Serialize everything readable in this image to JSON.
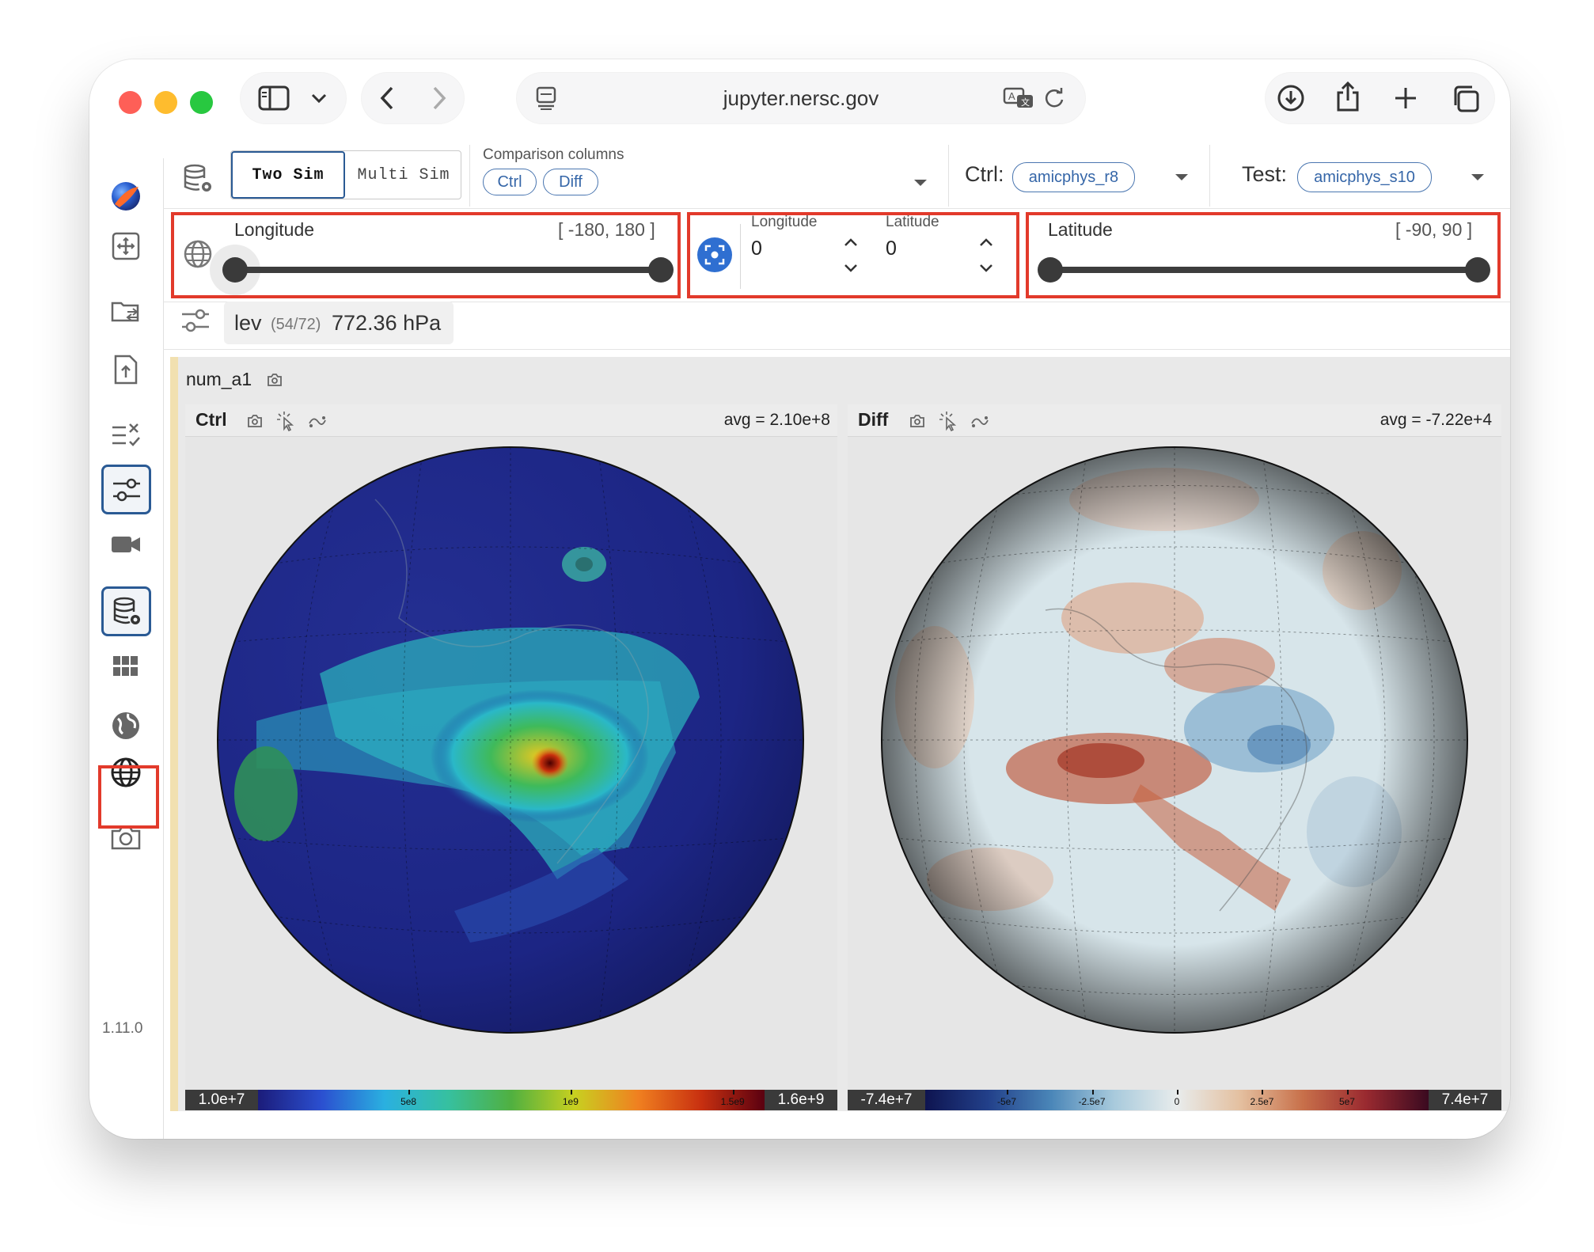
{
  "browser": {
    "url": "jupyter.nersc.gov",
    "traffic_colors": [
      "#fe5f57",
      "#febc2e",
      "#28c840"
    ]
  },
  "toolbar": {
    "mode_tabs": [
      {
        "label": "Two Sim",
        "active": true
      },
      {
        "label": "Multi Sim",
        "active": false
      }
    ],
    "comparison_label": "Comparison columns",
    "comparison_chips": [
      "Ctrl",
      "Diff"
    ],
    "ctrl_label": "Ctrl:",
    "ctrl_value": "amicphys_r8",
    "test_label": "Test:",
    "test_value": "amicphys_s10"
  },
  "longitude_slider": {
    "label": "Longitude",
    "range_text": "[ -180, 180 ]",
    "min": -180,
    "max": 180,
    "low": -180,
    "high": 180
  },
  "center_point": {
    "lon_label": "Longitude",
    "lon_value": "0",
    "lat_label": "Latitude",
    "lat_value": "0"
  },
  "latitude_slider": {
    "label": "Latitude",
    "range_text": "[ -90, 90 ]",
    "min": -90,
    "max": 90,
    "low": -90,
    "high": 90
  },
  "level": {
    "name": "lev",
    "index": "(54/72)",
    "value": "772.36 hPa"
  },
  "variable": {
    "name": "num_a1"
  },
  "plots": [
    {
      "title": "Ctrl",
      "avg": "avg = 2.10e+8",
      "cb_min": "1.0e+7",
      "cb_max": "1.6e+9",
      "ticks": [
        {
          "label": "5e8",
          "pos": 0.297
        },
        {
          "label": "1e9",
          "pos": 0.617
        },
        {
          "label": "1.5e9",
          "pos": 0.937
        }
      ]
    },
    {
      "title": "Diff",
      "avg": "avg = -7.22e+4",
      "cb_min": "-7.4e+7",
      "cb_max": "7.4e+7",
      "ticks": [
        {
          "label": "-5e7",
          "pos": 0.162
        },
        {
          "label": "-2.5e7",
          "pos": 0.331
        },
        {
          "label": "0",
          "pos": 0.5
        },
        {
          "label": "2.5e7",
          "pos": 0.669
        },
        {
          "label": "5e7",
          "pos": 0.838
        }
      ]
    }
  ],
  "version": "1.11.0",
  "sidebar_icons": [
    "app-logo-icon",
    "move-icon",
    "folder-swap-icon",
    "file-upload-icon",
    "checklist-icon",
    "sliders-icon",
    "camera-video-icon",
    "database-gear-icon",
    "grid-icon",
    "globe-solid-icon",
    "globe-outline-icon",
    "camera-icon"
  ]
}
